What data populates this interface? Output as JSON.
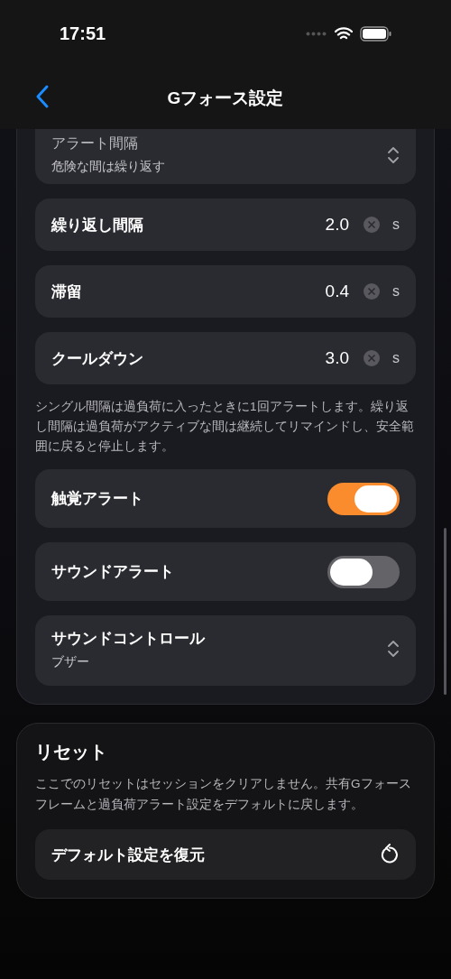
{
  "status_bar": {
    "time": "17:51"
  },
  "nav": {
    "title": "Gフォース設定"
  },
  "alerts": {
    "items": [
      {
        "kind": "select",
        "label": "アラート間隔",
        "value": "危険な間は繰り返す"
      },
      {
        "kind": "number",
        "label": "繰り返し間隔",
        "value": "2.0",
        "unit": "s"
      },
      {
        "kind": "number",
        "label": "滞留",
        "value": "0.4",
        "unit": "s"
      },
      {
        "kind": "number",
        "label": "クールダウン",
        "value": "3.0",
        "unit": "s"
      },
      {
        "kind": "note",
        "text": "シングル間隔は過負荷に入ったときに1回アラートします。繰り返し間隔は過負荷がアクティブな間は継続してリマインドし、安全範囲に戻ると停止します。"
      },
      {
        "kind": "toggle",
        "label": "触覚アラート",
        "on": true
      },
      {
        "kind": "toggle",
        "label": "サウンドアラート",
        "on": false
      },
      {
        "kind": "select",
        "label": "サウンドコントロール",
        "value": "ブザー"
      }
    ]
  },
  "reset": {
    "title": "リセット",
    "text": "ここでのリセットはセッションをクリアしません。共有Gフォースフレームと過負荷アラート設定をデフォルトに戻します。",
    "button": "デフォルト設定を復元"
  }
}
